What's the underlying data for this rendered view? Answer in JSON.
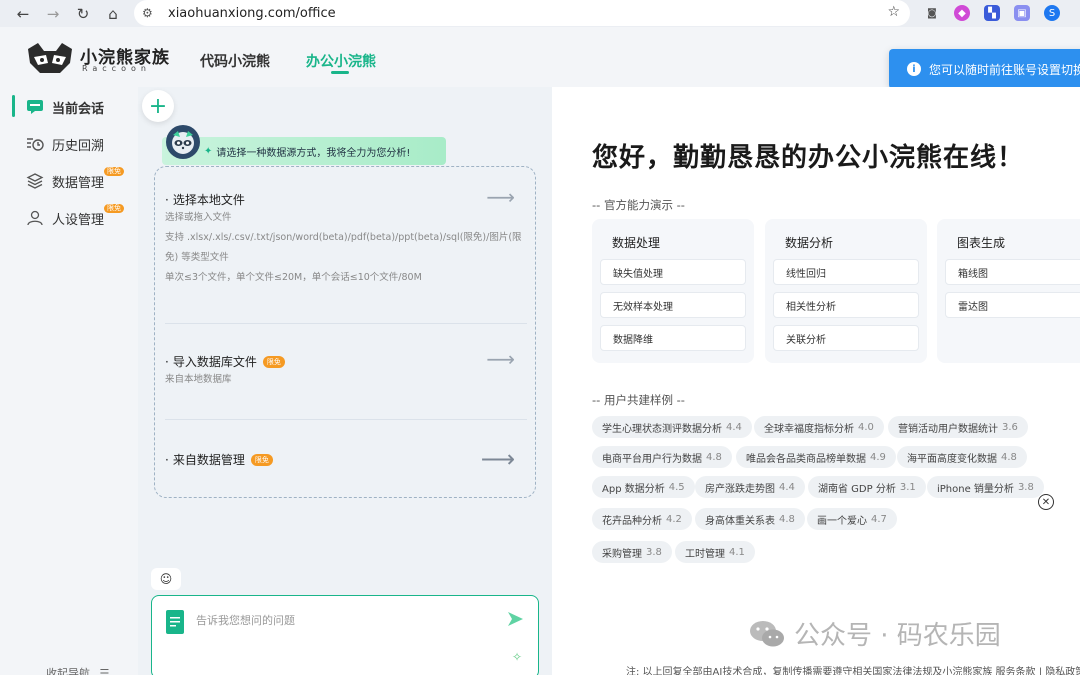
{
  "browser": {
    "url": "xiaohuanxiong.com/office",
    "back": "←",
    "forward": "→",
    "reload": "↻",
    "home": "⌂",
    "star": "☆"
  },
  "header": {
    "logo_title": "小浣熊家族",
    "logo_sub": "Raccoon",
    "tabs": [
      {
        "label": "代码小浣熊",
        "active": false
      },
      {
        "label": "办公小浣熊",
        "active": true
      }
    ]
  },
  "toast": {
    "text": "您可以随时前往账号设置切换"
  },
  "sidebar": {
    "items": [
      {
        "label": "当前会话",
        "icon": "chat-icon",
        "active": true
      },
      {
        "label": "历史回溯",
        "icon": "history-icon",
        "active": false
      },
      {
        "label": "数据管理",
        "icon": "database-icon",
        "active": false,
        "badge": "限免"
      },
      {
        "label": "人设管理",
        "icon": "user-icon",
        "active": false,
        "badge": "限免"
      }
    ],
    "collapse_label": "收起导航"
  },
  "left": {
    "plus": "+",
    "greeting": "请选择一种数据源方式，我将全力为您分析!",
    "sources": [
      {
        "title": "选择本地文件",
        "desc": [
          "选择或拖入文件",
          "支持 .xlsx/.xls/.csv/.txt/json/word(beta)/pdf(beta)/ppt(beta)/sql(限免)/图片(限",
          "免) 等类型文件",
          "单次≤3个文件，单个文件≤20M，单个会话≤10个文件/80M"
        ]
      },
      {
        "title": "导入数据库文件",
        "badge": "限免",
        "desc": [
          "来自本地数据库"
        ]
      },
      {
        "title": "来自数据管理",
        "badge": "限免",
        "desc": []
      }
    ],
    "input_placeholder": "告诉我您想问的问题"
  },
  "main": {
    "hello": "您好，勤勤恳恳的办公小浣熊在线！",
    "official_label": "-- 官方能力演示 --",
    "cards": [
      {
        "title": "数据处理",
        "items": [
          "缺失值处理",
          "无效样本处理",
          "数据降维"
        ]
      },
      {
        "title": "数据分析",
        "items": [
          "线性回归",
          "相关性分析",
          "关联分析"
        ]
      },
      {
        "title": "图表生成",
        "items": [
          "箱线图",
          "雷达图"
        ]
      }
    ],
    "community_label": "-- 用户共建样例 --",
    "examples": [
      {
        "name": "学生心理状态测评数据分析",
        "score": "4.4"
      },
      {
        "name": "全球幸福度指标分析",
        "score": "4.0"
      },
      {
        "name": "营销活动用户数据统计",
        "score": "3.6"
      },
      {
        "name": "电商平台用户行为数据",
        "score": "4.8"
      },
      {
        "name": "唯品会各品类商品榜单数据",
        "score": "4.9"
      },
      {
        "name": "海平面高度变化数据",
        "score": "4.8"
      },
      {
        "name": "App 数据分析",
        "score": "4.5"
      },
      {
        "name": "房产涨跌走势图",
        "score": "4.4"
      },
      {
        "name": "湖南省 GDP 分析",
        "score": "3.1"
      },
      {
        "name": "iPhone 销量分析",
        "score": "3.8"
      },
      {
        "name": "花卉品种分析",
        "score": "4.2"
      },
      {
        "name": "身高体重关系表",
        "score": "4.8"
      },
      {
        "name": "画一个爱心",
        "score": "4.7"
      },
      {
        "name": "采购管理",
        "score": "3.8"
      },
      {
        "name": "工时管理",
        "score": "4.1"
      }
    ],
    "watermark": "公众号 · 码农乐园",
    "footnote": "注: 以上回复全部由AI技术合成，复制传播需要遵守相关国家法律法规及小浣熊家族 服务条款 | 隐私政策"
  }
}
